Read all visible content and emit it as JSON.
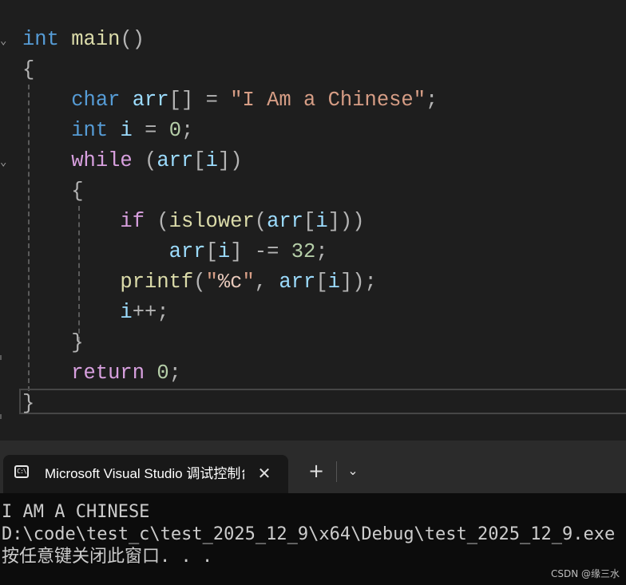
{
  "editor": {
    "lines": [
      [
        [
          "kw",
          "int"
        ],
        [
          "pun",
          " "
        ],
        [
          "fn",
          "main"
        ],
        [
          "pun",
          "()"
        ]
      ],
      [
        [
          "pun",
          "{"
        ]
      ],
      [
        [
          "pun",
          "    "
        ],
        [
          "kw",
          "char"
        ],
        [
          "pun",
          " "
        ],
        [
          "var",
          "arr"
        ],
        [
          "pun",
          "[] = "
        ],
        [
          "str",
          "\"I Am a Chinese\""
        ],
        [
          "pun",
          ";"
        ]
      ],
      [
        [
          "pun",
          "    "
        ],
        [
          "kw",
          "int"
        ],
        [
          "pun",
          " "
        ],
        [
          "var",
          "i"
        ],
        [
          "pun",
          " = "
        ],
        [
          "num",
          "0"
        ],
        [
          "pun",
          ";"
        ]
      ],
      [
        [
          "pun",
          "    "
        ],
        [
          "ctrl",
          "while"
        ],
        [
          "pun",
          " ("
        ],
        [
          "var",
          "arr"
        ],
        [
          "pun",
          "["
        ],
        [
          "var",
          "i"
        ],
        [
          "pun",
          "])"
        ]
      ],
      [
        [
          "pun",
          "    {"
        ]
      ],
      [
        [
          "pun",
          "        "
        ],
        [
          "ctrl",
          "if"
        ],
        [
          "pun",
          " ("
        ],
        [
          "fn",
          "islower"
        ],
        [
          "pun",
          "("
        ],
        [
          "var",
          "arr"
        ],
        [
          "pun",
          "["
        ],
        [
          "var",
          "i"
        ],
        [
          "pun",
          "]))"
        ]
      ],
      [
        [
          "pun",
          "            "
        ],
        [
          "var",
          "arr"
        ],
        [
          "pun",
          "["
        ],
        [
          "var",
          "i"
        ],
        [
          "pun",
          "] -= "
        ],
        [
          "num",
          "32"
        ],
        [
          "pun",
          ";"
        ]
      ],
      [
        [
          "pun",
          "        "
        ],
        [
          "fn",
          "printf"
        ],
        [
          "pun",
          "("
        ],
        [
          "str",
          "\""
        ],
        [
          "fmt",
          "%c"
        ],
        [
          "str",
          "\""
        ],
        [
          "pun",
          ", "
        ],
        [
          "var",
          "arr"
        ],
        [
          "pun",
          "["
        ],
        [
          "var",
          "i"
        ],
        [
          "pun",
          "]);"
        ]
      ],
      [
        [
          "pun",
          "        "
        ],
        [
          "var",
          "i"
        ],
        [
          "pun",
          "++;"
        ]
      ],
      [
        [
          "pun",
          "    }"
        ]
      ],
      [
        [
          "pun",
          "    "
        ],
        [
          "ctrl",
          "return"
        ],
        [
          "pun",
          " "
        ],
        [
          "num",
          "0"
        ],
        [
          "pun",
          ";"
        ]
      ],
      [
        [
          "pun",
          "}"
        ]
      ]
    ]
  },
  "terminal": {
    "tab_title": "Microsoft Visual Studio 调试控制台",
    "icon_name": "terminal-icon",
    "close_symbol": "✕",
    "new_tab_symbol": "+",
    "dropdown_symbol": "⌄",
    "output": [
      "I AM A CHINESE",
      "D:\\code\\test_c\\test_2025_12_9\\x64\\Debug\\test_2025_12_9.exe",
      "按任意键关闭此窗口. . ."
    ]
  },
  "watermark": "CSDN @缘三水"
}
